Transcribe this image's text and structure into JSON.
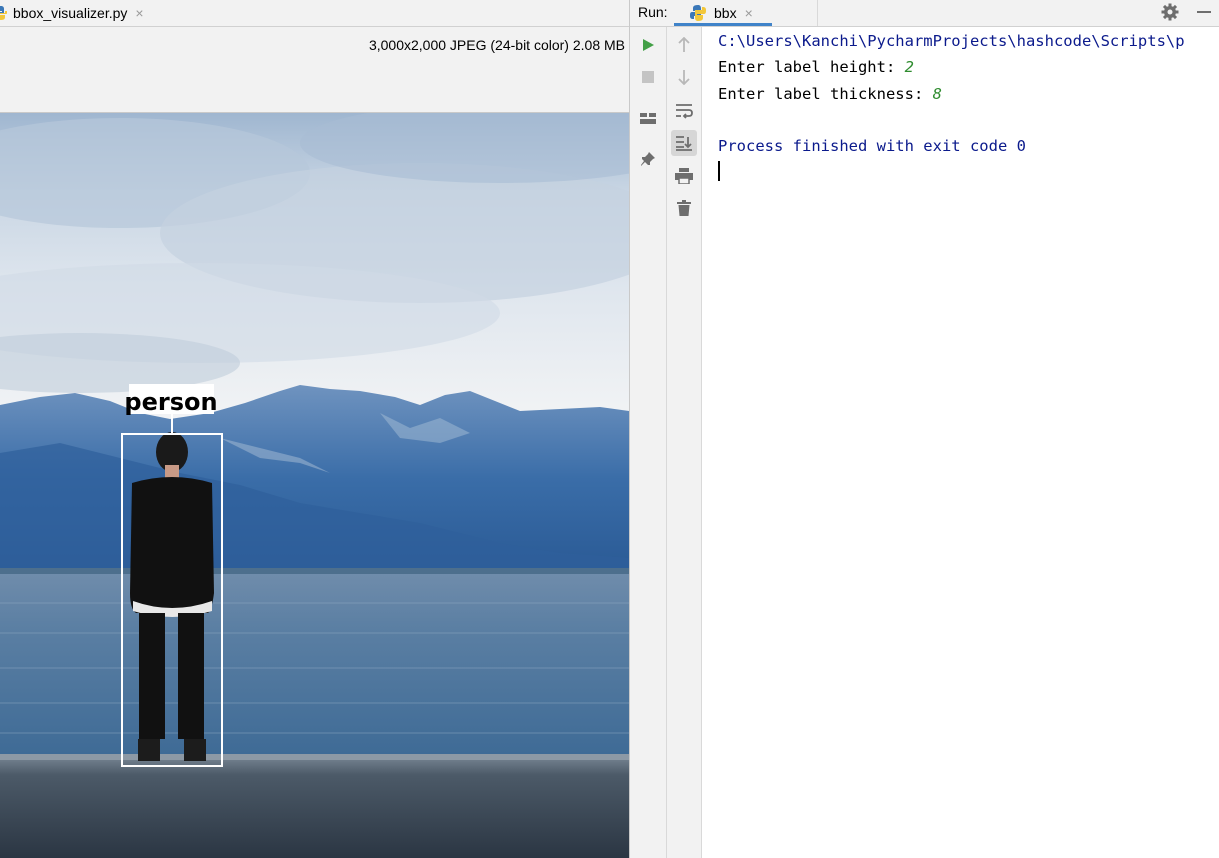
{
  "editor": {
    "tab_label": "bbox_visualizer.py",
    "tab_close": "×",
    "image_info": "3,000x2,000 JPEG (24-bit color) 2.08 MB"
  },
  "image": {
    "detection_label": "person"
  },
  "run": {
    "label": "Run:",
    "tab_label": "bbx",
    "tab_close": "×",
    "accent_color": "#4083c9"
  },
  "console": {
    "path_line": "C:\\Users\\Kanchi\\PycharmProjects\\hashcode\\Scripts\\p",
    "prompt_height": "Enter label height: ",
    "height_value": "2",
    "prompt_thickness": "Enter label thickness: ",
    "thickness_value": "8",
    "process_line": "Process finished with exit code 0"
  },
  "icons": {
    "run": "play-icon",
    "stop": "stop-icon",
    "up": "arrow-up-icon",
    "down": "arrow-down-icon",
    "wrap": "soft-wrap-icon",
    "scroll": "scroll-to-end-icon",
    "print": "print-icon",
    "trash": "trash-icon",
    "layout": "layout-icon",
    "pin": "pin-icon",
    "gear": "gear-icon",
    "minimize": "minimize-icon"
  }
}
